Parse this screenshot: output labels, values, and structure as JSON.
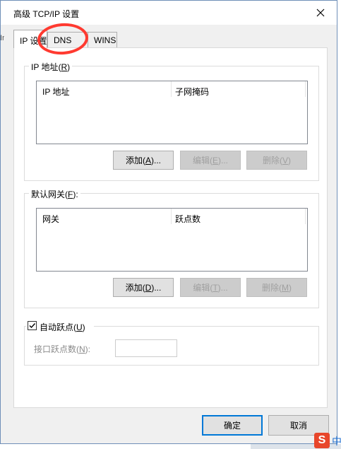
{
  "window": {
    "title": "高级 TCP/IP 设置",
    "close_symbol": "✕"
  },
  "background_peek": "In",
  "tabs": [
    {
      "label": "IP 设置",
      "active": true
    },
    {
      "label": "DNS",
      "active": false
    },
    {
      "label": "WINS",
      "active": false
    }
  ],
  "ip_group": {
    "legend": "IP 地址(R)",
    "columns": [
      "IP 地址",
      "子网掩码"
    ],
    "buttons": {
      "add": "添加(A)...",
      "edit": "编辑(E)...",
      "delete": "删除(V)"
    }
  },
  "gateway_group": {
    "legend": "默认网关(F):",
    "columns": [
      "网关",
      "跃点数"
    ],
    "buttons": {
      "add": "添加(D)...",
      "edit": "编辑(T)...",
      "delete": "删除(M)"
    }
  },
  "metric_group": {
    "auto_metric_label": "自动跃点(U)",
    "auto_metric_checked": true,
    "interface_metric_label": "接口跃点数(N):",
    "interface_metric_value": ""
  },
  "footer": {
    "ok": "确定",
    "cancel": "取消"
  },
  "taskbar": {
    "ime_icon_letter": "S",
    "ime_label": "中"
  },
  "colors": {
    "annotation_circle": "#ff3a30",
    "default_button_border": "#0078d7",
    "ime_icon_bg": "#e8462b"
  }
}
